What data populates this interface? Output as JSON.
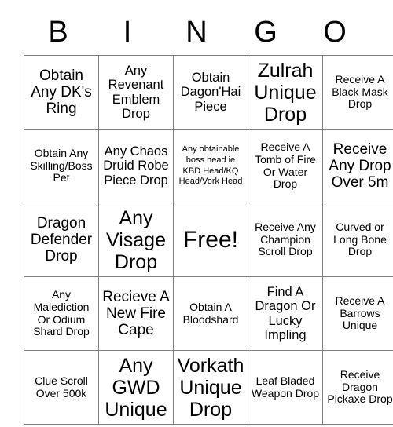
{
  "card": {
    "headers": [
      "B",
      "I",
      "N",
      "G",
      "O"
    ],
    "rows": [
      [
        {
          "text": "Obtain Any DK's Ring",
          "size": "lg"
        },
        {
          "text": "Any Revenant Emblem Drop",
          "size": "md"
        },
        {
          "text": "Obtain Dagon'Hai Piece",
          "size": "md"
        },
        {
          "text": "Zulrah Unique Drop",
          "size": "xl"
        },
        {
          "text": "Receive A Black Mask Drop",
          "size": "sm"
        }
      ],
      [
        {
          "text": "Obtain Any Skilling/Boss Pet",
          "size": "sm"
        },
        {
          "text": "Any Chaos Druid Robe Piece Drop",
          "size": "md"
        },
        {
          "text": "Any obtainable boss head ie KBD Head/KQ Head/Vork Head",
          "size": "xs"
        },
        {
          "text": "Receive A Tomb of Fire Or Water Drop",
          "size": "sm"
        },
        {
          "text": "Receive Any Drop Over 5m",
          "size": "lg"
        }
      ],
      [
        {
          "text": "Dragon Defender Drop",
          "size": "lg"
        },
        {
          "text": "Any Visage Drop",
          "size": "xl"
        },
        {
          "text": "Free!",
          "size": "free"
        },
        {
          "text": "Receive Any Champion Scroll Drop",
          "size": "sm"
        },
        {
          "text": "Curved or Long Bone Drop",
          "size": "sm"
        }
      ],
      [
        {
          "text": "Any Malediction Or Odium Shard Drop",
          "size": "sm"
        },
        {
          "text": "Recieve A New Fire Cape",
          "size": "lg"
        },
        {
          "text": "Obtain A Bloodshard",
          "size": "sm"
        },
        {
          "text": "Find A Dragon Or Lucky Impling",
          "size": "md"
        },
        {
          "text": "Receive A Barrows Unique",
          "size": "sm"
        }
      ],
      [
        {
          "text": "Clue Scroll Over 500k",
          "size": "sm"
        },
        {
          "text": "Any GWD Unique",
          "size": "xl"
        },
        {
          "text": "Vorkath Unique Drop",
          "size": "xl"
        },
        {
          "text": "Leaf Bladed Weapon Drop",
          "size": "sm"
        },
        {
          "text": "Receive Dragon Pickaxe Drop",
          "size": "sm"
        }
      ]
    ]
  },
  "colors": {
    "background": "#ffffff",
    "text": "#000000",
    "grid_line": "#808080"
  }
}
